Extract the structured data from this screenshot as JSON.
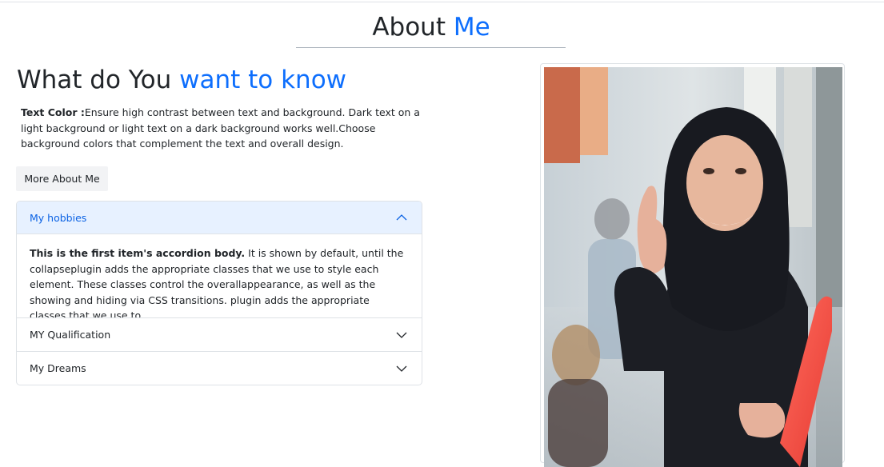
{
  "page": {
    "title_main": "About",
    "title_accent": "Me"
  },
  "section": {
    "title_main": "What do You",
    "title_accent": "want to know",
    "intro_bold": "Text Color :",
    "intro_text": "Ensure high contrast between text and background. Dark text on a light background or light text on a dark background works well.Choose background colors that complement the text and overall design."
  },
  "more_button": {
    "label": "More About Me"
  },
  "accordion": {
    "items": [
      {
        "label": "My hobbies",
        "expanded": true,
        "icon": "chevron-up-icon",
        "body_bold": "This is the first item's accordion body.",
        "body_text": " It is shown by default, until the collapseplugin adds the appropriate classes that we use to style each element. These classes control the overallappearance, as well as the showing and hiding via CSS transitions. plugin adds the appropriate classes that we use to"
      },
      {
        "label": "MY Qualification",
        "expanded": false,
        "icon": "chevron-down-icon"
      },
      {
        "label": "My Dreams",
        "expanded": false,
        "icon": "chevron-down-icon"
      }
    ]
  },
  "colors": {
    "accent": "#0d6efd",
    "text": "#212529",
    "accordion_active_bg": "#e7f1ff",
    "accordion_active_text": "#0c63e4",
    "button_bg": "#f2f3f5"
  }
}
